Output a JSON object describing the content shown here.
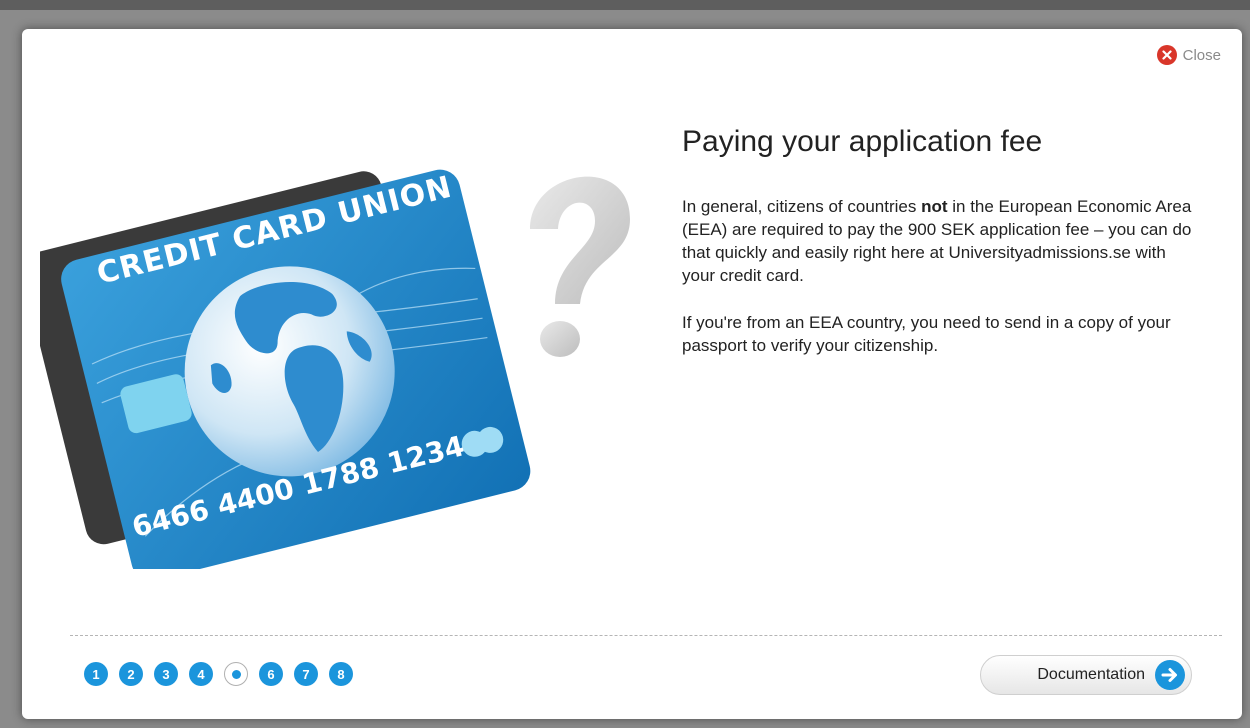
{
  "modal": {
    "close_label": "Close",
    "title": "Paying your application fee",
    "paragraph1_before": "In general, citizens of countries ",
    "paragraph1_bold": "not",
    "paragraph1_after": " in the European Economic Area (EEA) are required to pay the 900 SEK application fee – you can do that quickly and easily right here at Universityadmissions.se with your credit card.",
    "paragraph2": "If you're from an EEA country, you need to send in a copy of your passport to verify your citizenship."
  },
  "card": {
    "brand": "CREDIT CARD UNION",
    "number": "6466 4400 1788 1234"
  },
  "pager": {
    "pages": [
      "1",
      "2",
      "3",
      "4",
      "5",
      "6",
      "7",
      "8"
    ],
    "current": 5
  },
  "footer": {
    "next_label": "Documentation"
  },
  "colors": {
    "accent": "#1b95dc",
    "close": "#d9362a"
  }
}
